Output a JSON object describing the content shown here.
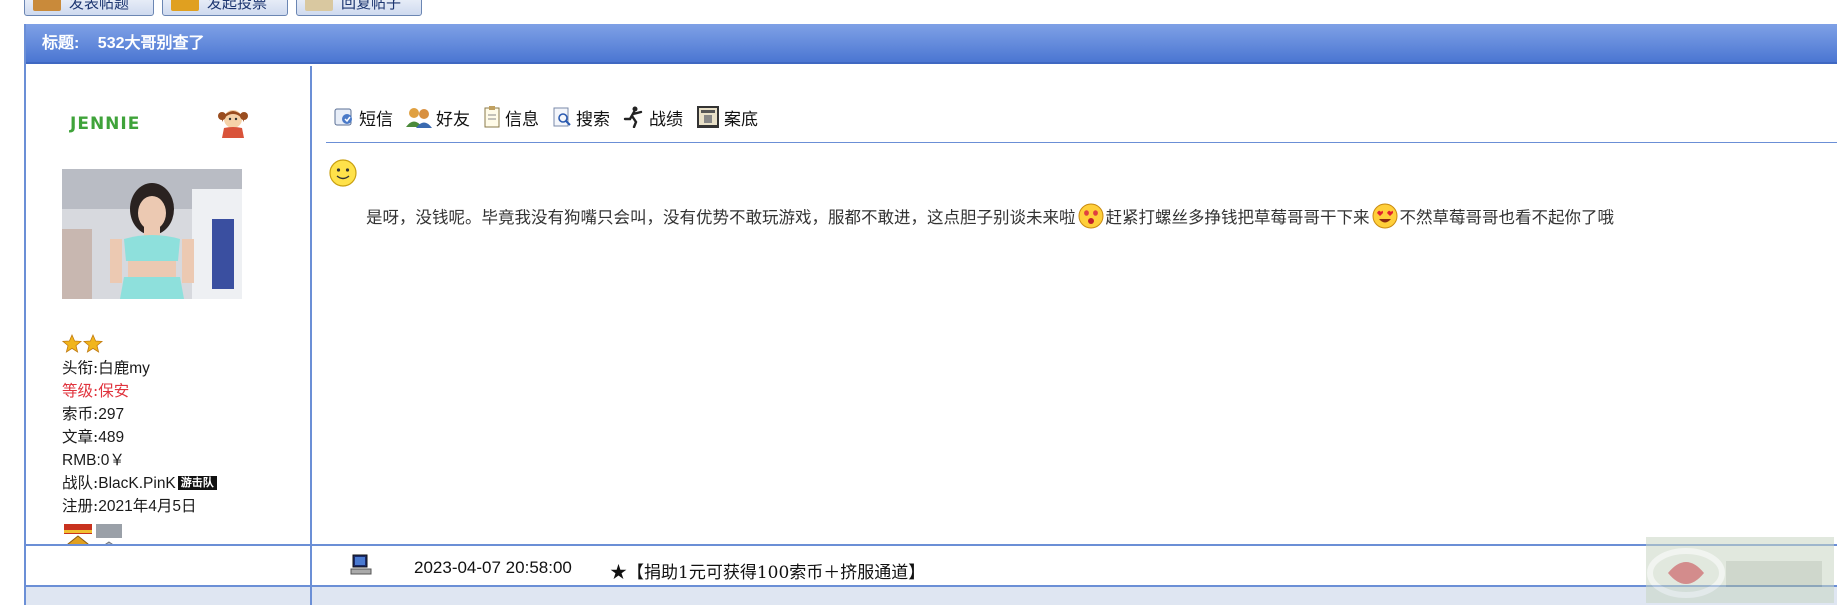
{
  "top_buttons": [
    {
      "label": "发表帖题",
      "color": "#c98a3a"
    },
    {
      "label": "发起投票",
      "color": "#e0a020"
    },
    {
      "label": "回复帖子",
      "color": "#d9c8a0"
    }
  ],
  "post": {
    "title_label": "标题:",
    "title": "532大哥别查了",
    "user": {
      "name": "JENNIE",
      "stats": {
        "title_label": "头衔:",
        "title_value": "白鹿my",
        "level_label": "等级:",
        "level_value": "保安",
        "coins_label": "索币:",
        "coins_value": "297",
        "articles_label": "文章:",
        "articles_value": "489",
        "rmb_label": "RMB:",
        "rmb_value": "0￥",
        "team_label": "战队:",
        "team_value": "BlacK.PinK",
        "team_tag": "游击队",
        "reg_label": "注册:",
        "reg_value": "2021年4月5日"
      }
    },
    "toolbar": [
      {
        "label": "短信",
        "icon": "message-icon"
      },
      {
        "label": "好友",
        "icon": "friends-icon"
      },
      {
        "label": "信息",
        "icon": "info-icon"
      },
      {
        "label": "搜索",
        "icon": "search-icon"
      },
      {
        "label": "战绩",
        "icon": "record-icon"
      },
      {
        "label": "案底",
        "icon": "file-icon"
      }
    ],
    "message": {
      "part1": "是呀，没钱呢。毕竟我没有狗嘴只会叫，没有优势不敢玩游戏，服都不敢进，这点胆子别谈未来啦",
      "part2": "赶紧打螺丝多挣钱把草莓哥哥干下来",
      "part3": "不然草莓哥哥也看不起你了哦"
    },
    "footer": {
      "time": "2023-04-07 20:58:00",
      "donate": "★【捐助1元可获得100索币＋挤服通道】"
    }
  },
  "colors": {
    "title_bar": "#4b76d2",
    "border": "#6b8fd6",
    "username": "#3fa33a",
    "level": "#e0333d"
  }
}
